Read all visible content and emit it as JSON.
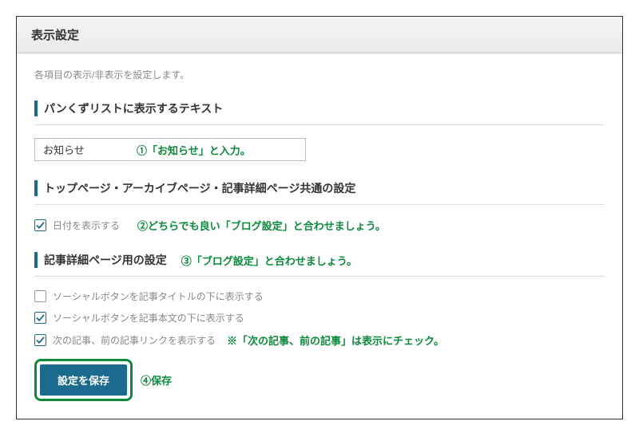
{
  "header": {
    "title": "表示設定"
  },
  "description": "各項目の表示/非表示を設定します。",
  "sections": {
    "breadcrumb": {
      "title": "パンくずリストに表示するテキスト",
      "input_value": "お知らせ",
      "annotation": "①「お知らせ」と入力。"
    },
    "common": {
      "title": "トップページ・アーカイブページ・記事詳細ページ共通の設定",
      "items": [
        {
          "label": "日付を表示する",
          "checked": true
        }
      ],
      "annotation": "②どちらでも良い「ブログ設定」と合わせましょう。"
    },
    "detail": {
      "title": "記事詳細ページ用の設定",
      "title_annotation": "③「ブログ設定」と合わせましょう。",
      "items": [
        {
          "label": "ソーシャルボタンを記事タイトルの下に表示する",
          "checked": false,
          "annot": ""
        },
        {
          "label": "ソーシャルボタンを記事本文の下に表示する",
          "checked": true,
          "annot": ""
        },
        {
          "label": "次の記事、前の記事リンクを表示する",
          "checked": true,
          "annot": "※「次の記事、前の記事」は表示にチェック。"
        }
      ]
    }
  },
  "save": {
    "button_label": "設定を保存",
    "annotation": "④保存"
  }
}
